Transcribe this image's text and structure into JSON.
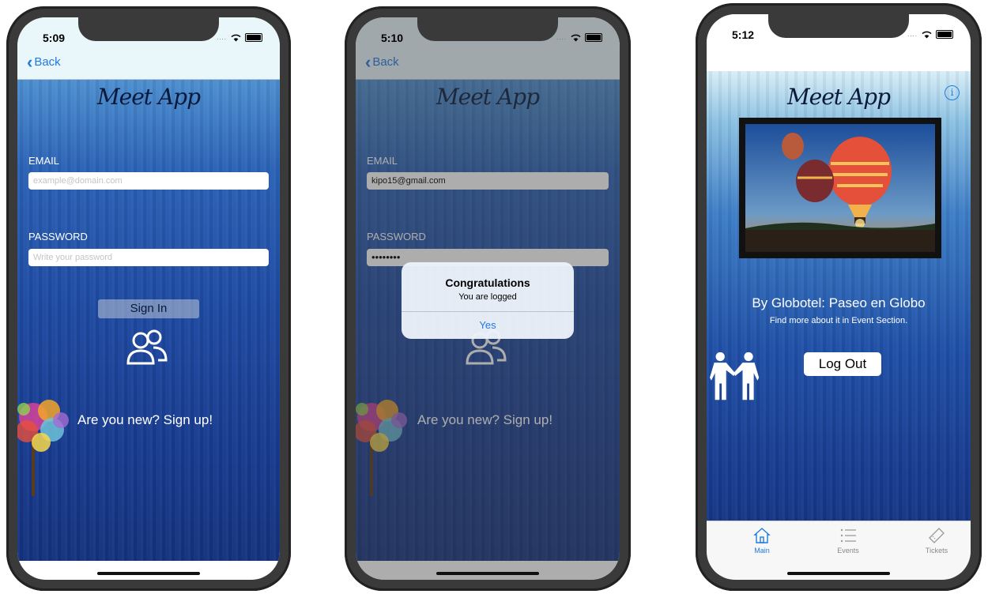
{
  "phone1": {
    "time": "5:09",
    "back_label": "Back",
    "logo": "Meet App",
    "email_label": "EMAIL",
    "email_placeholder": "example@domain.com",
    "password_label": "PASSWORD",
    "password_placeholder": "Write your password",
    "signin_label": "Sign In",
    "signup_text": "Are you new? Sign up!"
  },
  "phone2": {
    "time": "5:10",
    "back_label": "Back",
    "logo": "Meet App",
    "email_label": "EMAIL",
    "email_value": "kipo15@gmail.com",
    "password_label": "PASSWORD",
    "password_value": "••••••••",
    "signup_text": "Are you new? Sign up!",
    "alert": {
      "title": "Congratulations",
      "message": "You are logged",
      "button": "Yes"
    }
  },
  "phone3": {
    "time": "5:12",
    "logo": "Meet App",
    "event_title": "By Globotel: Paseo en Globo",
    "event_subtitle": "Find more about it in Event Section.",
    "logout_label": "Log Out",
    "tabs": [
      {
        "label": "Main",
        "icon": "home-icon",
        "active": true
      },
      {
        "label": "Events",
        "icon": "list-icon",
        "active": false
      },
      {
        "label": "Tickets",
        "icon": "ticket-icon",
        "active": false
      }
    ]
  },
  "colors": {
    "accent": "#1f7ae0",
    "background_blue": "#1e4aa2",
    "phone_frame": "#3a3a3a"
  }
}
